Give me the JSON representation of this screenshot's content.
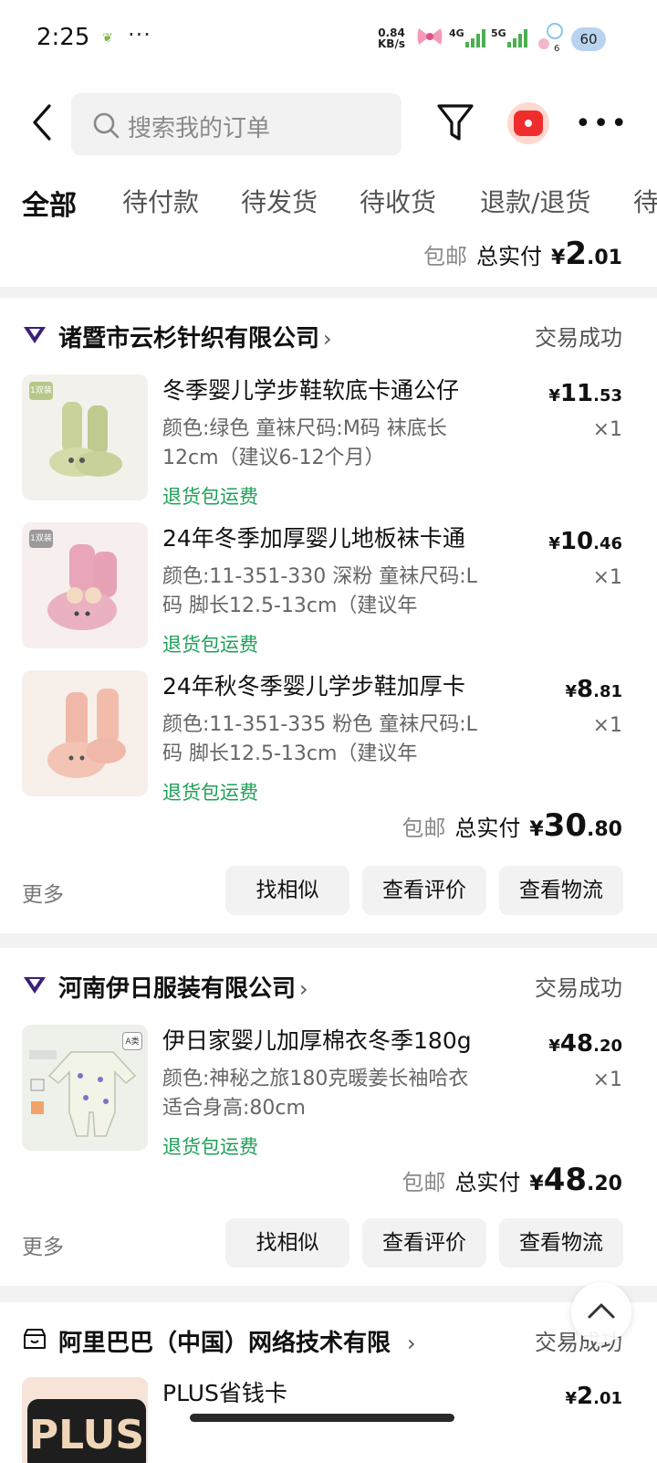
{
  "status_bar": {
    "time": "2:25",
    "net_speed_value": "0.84",
    "net_speed_unit": "KB/s",
    "signal_4g": "4G",
    "signal_5g": "5G",
    "notif_count": "6",
    "battery": "60"
  },
  "header": {
    "search_placeholder": "搜索我的订单"
  },
  "tabs": [
    {
      "label": "全部",
      "active": true
    },
    {
      "label": "待付款"
    },
    {
      "label": "待发货"
    },
    {
      "label": "待收货"
    },
    {
      "label": "退款/退货"
    },
    {
      "label": "待"
    }
  ],
  "top_card": {
    "shipping": "包邮",
    "total_label": "总实付",
    "currency": "¥",
    "total_int": "2",
    "total_dec": ".01"
  },
  "orders": [
    {
      "shop": "诸暨市云杉针织有限公司",
      "status": "交易成功",
      "items": [
        {
          "title": "冬季婴儿学步鞋软底卡通公仔",
          "spec": "颜色:绿色 童袜尺码:M码 袜底长12cm（建议6-12个月）",
          "return": "退货包运费",
          "price_int": "11",
          "price_dec": ".53",
          "qty": "×1",
          "tag": "1双装"
        },
        {
          "title": "24年冬季加厚婴儿地板袜卡通",
          "spec": "颜色:11-351-330 深粉 童袜尺码:L码 脚长12.5-13cm（建议年",
          "return": "退货包运费",
          "price_int": "10",
          "price_dec": ".46",
          "qty": "×1",
          "tag": "1双装"
        },
        {
          "title": "24年秋冬季婴儿学步鞋加厚卡",
          "spec": "颜色:11-351-335 粉色 童袜尺码:L码 脚长12.5-13cm（建议年",
          "return": "退货包运费",
          "price_int": "8",
          "price_dec": ".81",
          "qty": "×1"
        }
      ],
      "shipping": "包邮",
      "total_label": "总实付",
      "total_int": "30",
      "total_dec": ".80",
      "more": "更多",
      "buttons": [
        "找相似",
        "查看评价",
        "查看物流"
      ]
    },
    {
      "shop": "河南伊日服装有限公司",
      "status": "交易成功",
      "items": [
        {
          "title": "伊日家婴儿加厚棉衣冬季180g",
          "spec": "颜色:神秘之旅180克暖姜长袖哈衣 适合身高:80cm",
          "return": "退货包运费",
          "price_int": "48",
          "price_dec": ".20",
          "qty": "×1",
          "tag": "A类"
        }
      ],
      "shipping": "包邮",
      "total_label": "总实付",
      "total_int": "48",
      "total_dec": ".20",
      "more": "更多",
      "buttons": [
        "找相似",
        "查看评价",
        "查看物流"
      ]
    },
    {
      "shop": "阿里巴巴（中国）网络技术有限",
      "status": "交易成功",
      "items": [
        {
          "title": "PLUS省钱卡",
          "price_int": "2",
          "price_dec": ".01",
          "thumb_text": "PLUS"
        }
      ]
    }
  ],
  "currency": "¥",
  "colors": {
    "accent_green": "#1fa058",
    "brand_red": "#f02d2d",
    "shop_icon": "#3a1f7a"
  }
}
